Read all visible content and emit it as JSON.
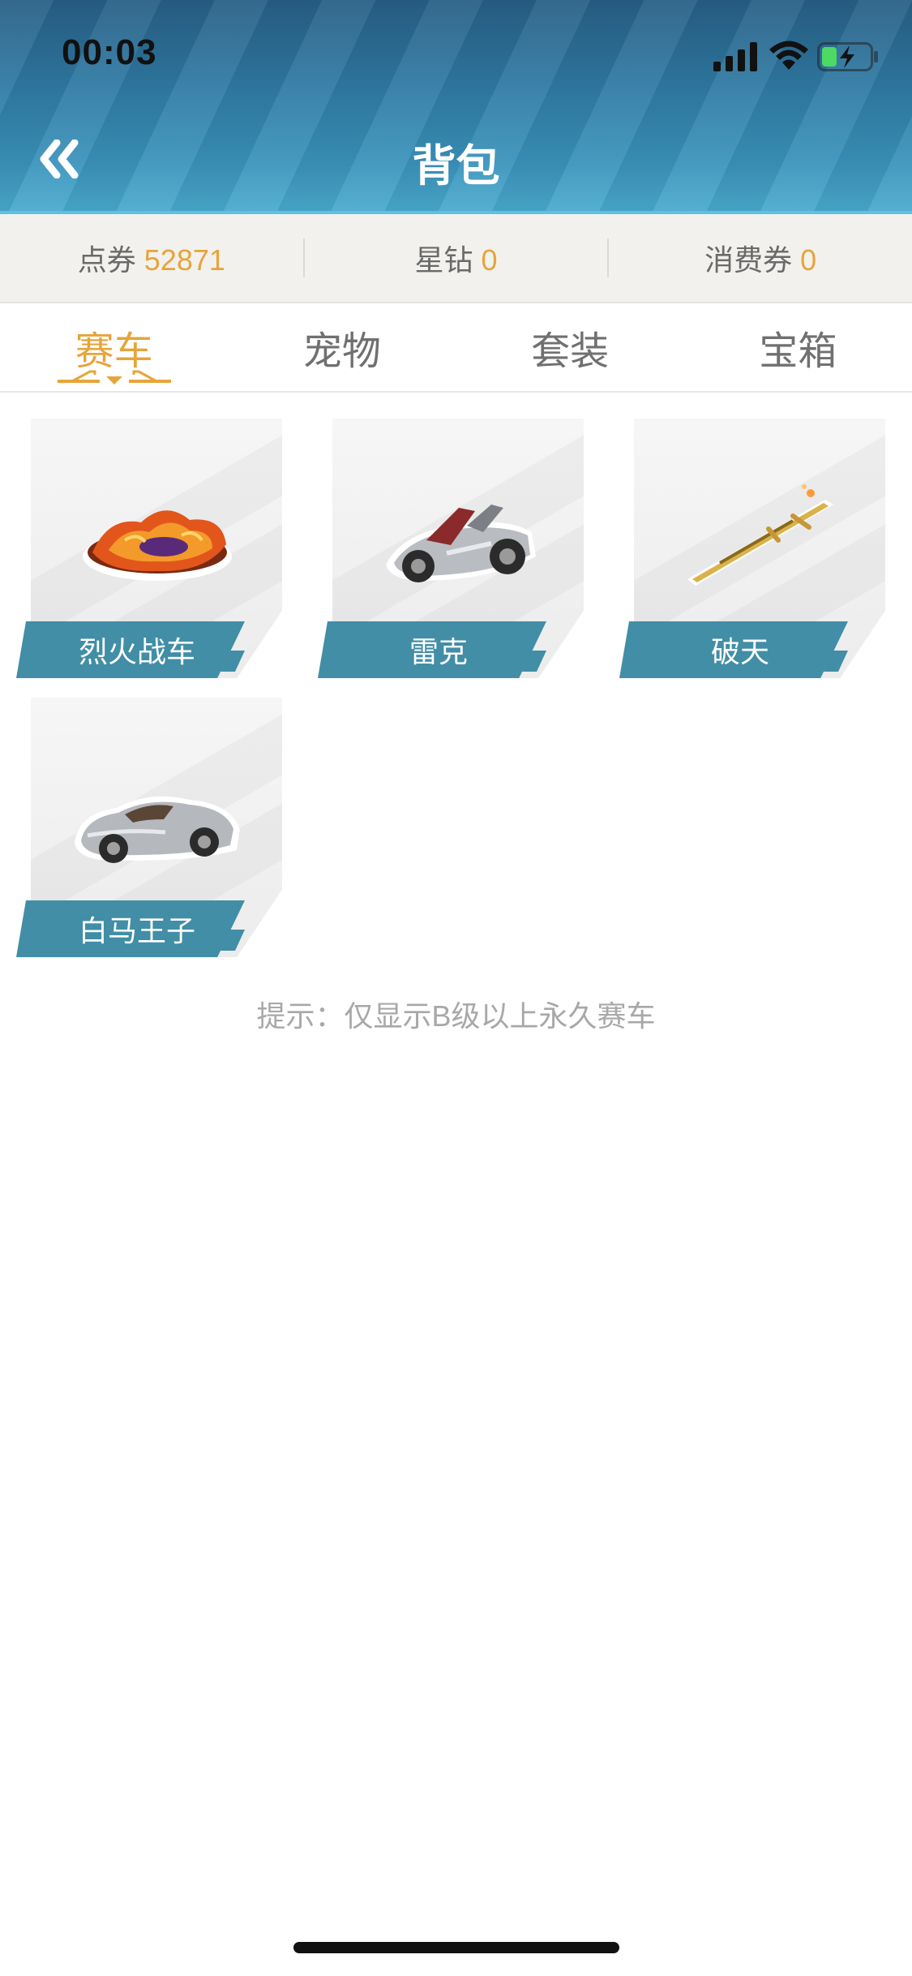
{
  "status_bar": {
    "time": "00:03",
    "icons": [
      "signal-icon",
      "wifi-icon",
      "battery-charging-icon"
    ]
  },
  "header": {
    "back_icon": "double-chevron-left-icon",
    "title": "背包"
  },
  "currency": [
    {
      "label": "点券",
      "value": "52871"
    },
    {
      "label": "星钻",
      "value": "0"
    },
    {
      "label": "消费券",
      "value": "0"
    }
  ],
  "tabs": [
    {
      "label": "赛车",
      "active": true
    },
    {
      "label": "宠物",
      "active": false
    },
    {
      "label": "套装",
      "active": false
    },
    {
      "label": "宝箱",
      "active": false
    }
  ],
  "items": [
    {
      "name": "烈火战车",
      "icon": "flame-car-icon"
    },
    {
      "name": "雷克",
      "icon": "kart-icon"
    },
    {
      "name": "破天",
      "icon": "sword-car-icon"
    },
    {
      "name": "白马王子",
      "icon": "sports-car-icon"
    }
  ],
  "hint": "提示：仅显示B级以上永久赛车",
  "colors": {
    "accent": "#e6a53a",
    "label_bg": "#418ea6",
    "header_top": "#285f86",
    "header_bottom": "#4aaccf"
  }
}
